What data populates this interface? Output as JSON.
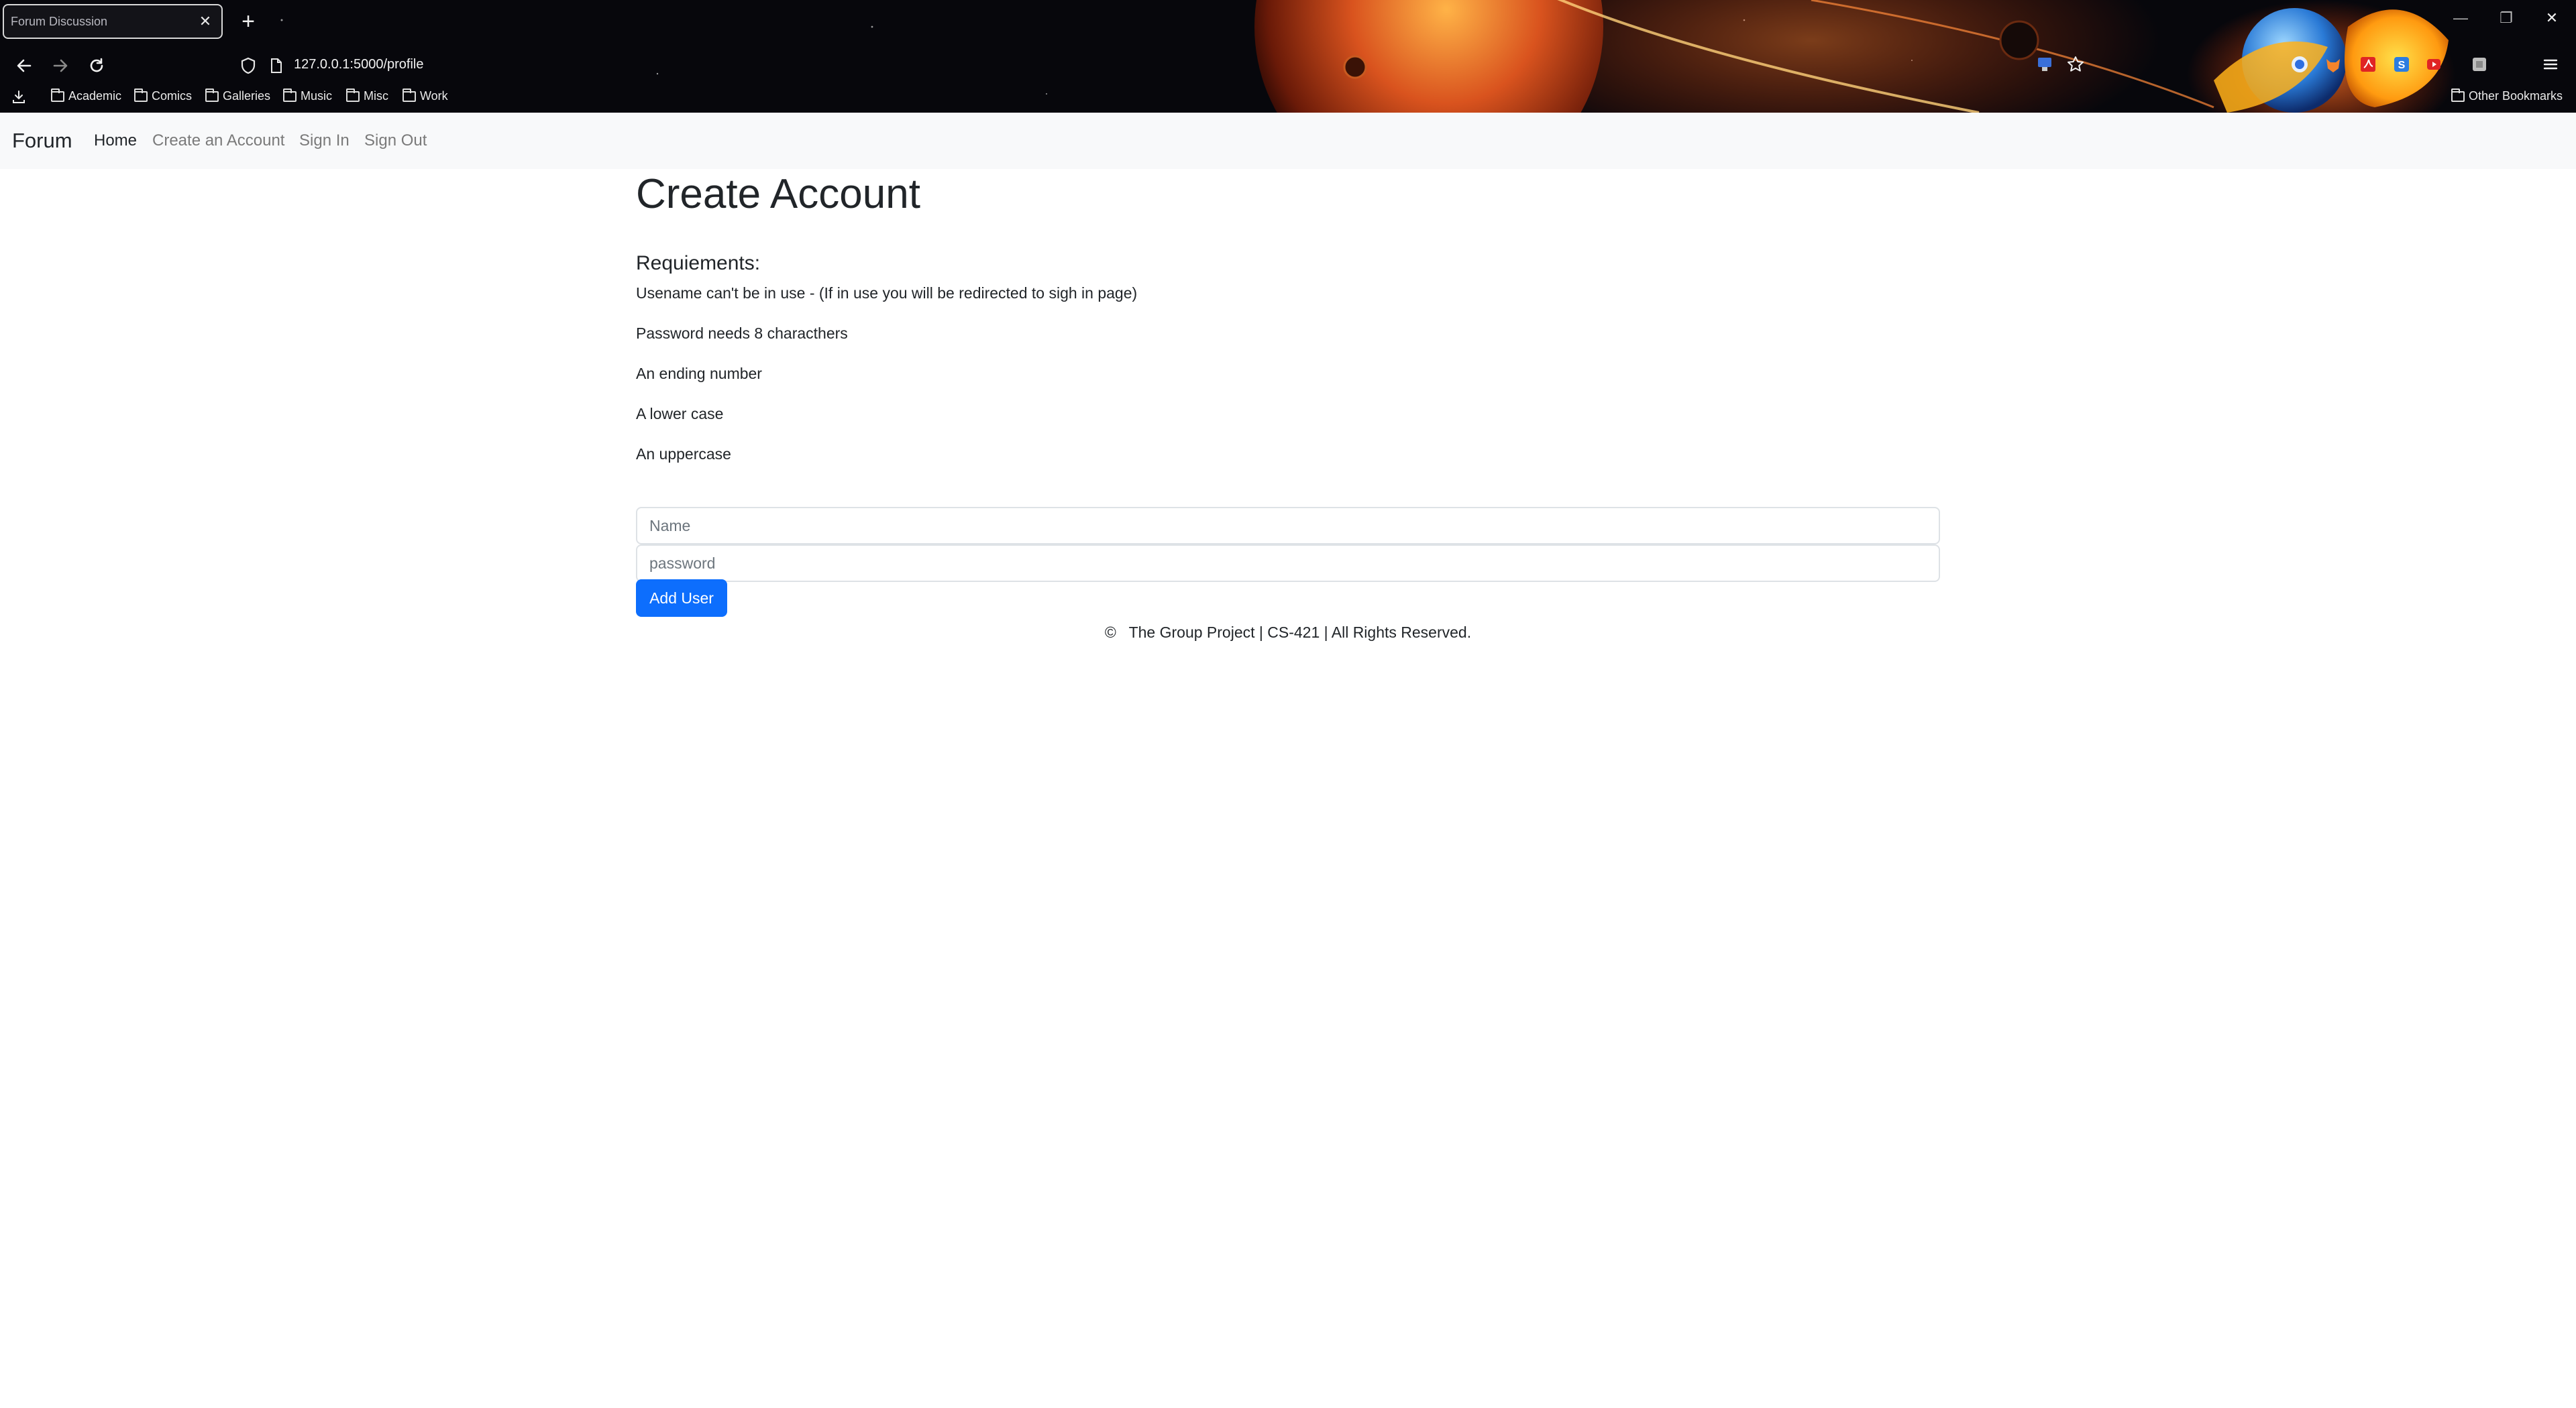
{
  "browser": {
    "tab_title": "Forum Discussion",
    "url": "127.0.0.1:5000/profile",
    "bookmarks": [
      "Academic",
      "Comics",
      "Galleries",
      "Music",
      "Misc",
      "Work"
    ],
    "other_bookmarks": "Other Bookmarks"
  },
  "site_nav": {
    "brand": "Forum",
    "links": [
      "Home",
      "Create an Account",
      "Sign In",
      "Sign Out"
    ]
  },
  "main": {
    "title": "Create Account",
    "requirements_heading": "Requiements:",
    "requirements": [
      "Usename can't be in use - (If in use you will be redirected to sigh in page)",
      "Password needs 8 characthers",
      "An ending number",
      "A lower case",
      "An uppercase"
    ],
    "name_placeholder": "Name",
    "password_placeholder": "password",
    "submit_label": "Add User"
  },
  "footer": {
    "text": "©   The Group Project | CS-421 | All Rights Reserved."
  },
  "colors": {
    "primary": "#0d6efd",
    "nav_background": "#f8f9fa",
    "chrome_background": "#07070c"
  }
}
